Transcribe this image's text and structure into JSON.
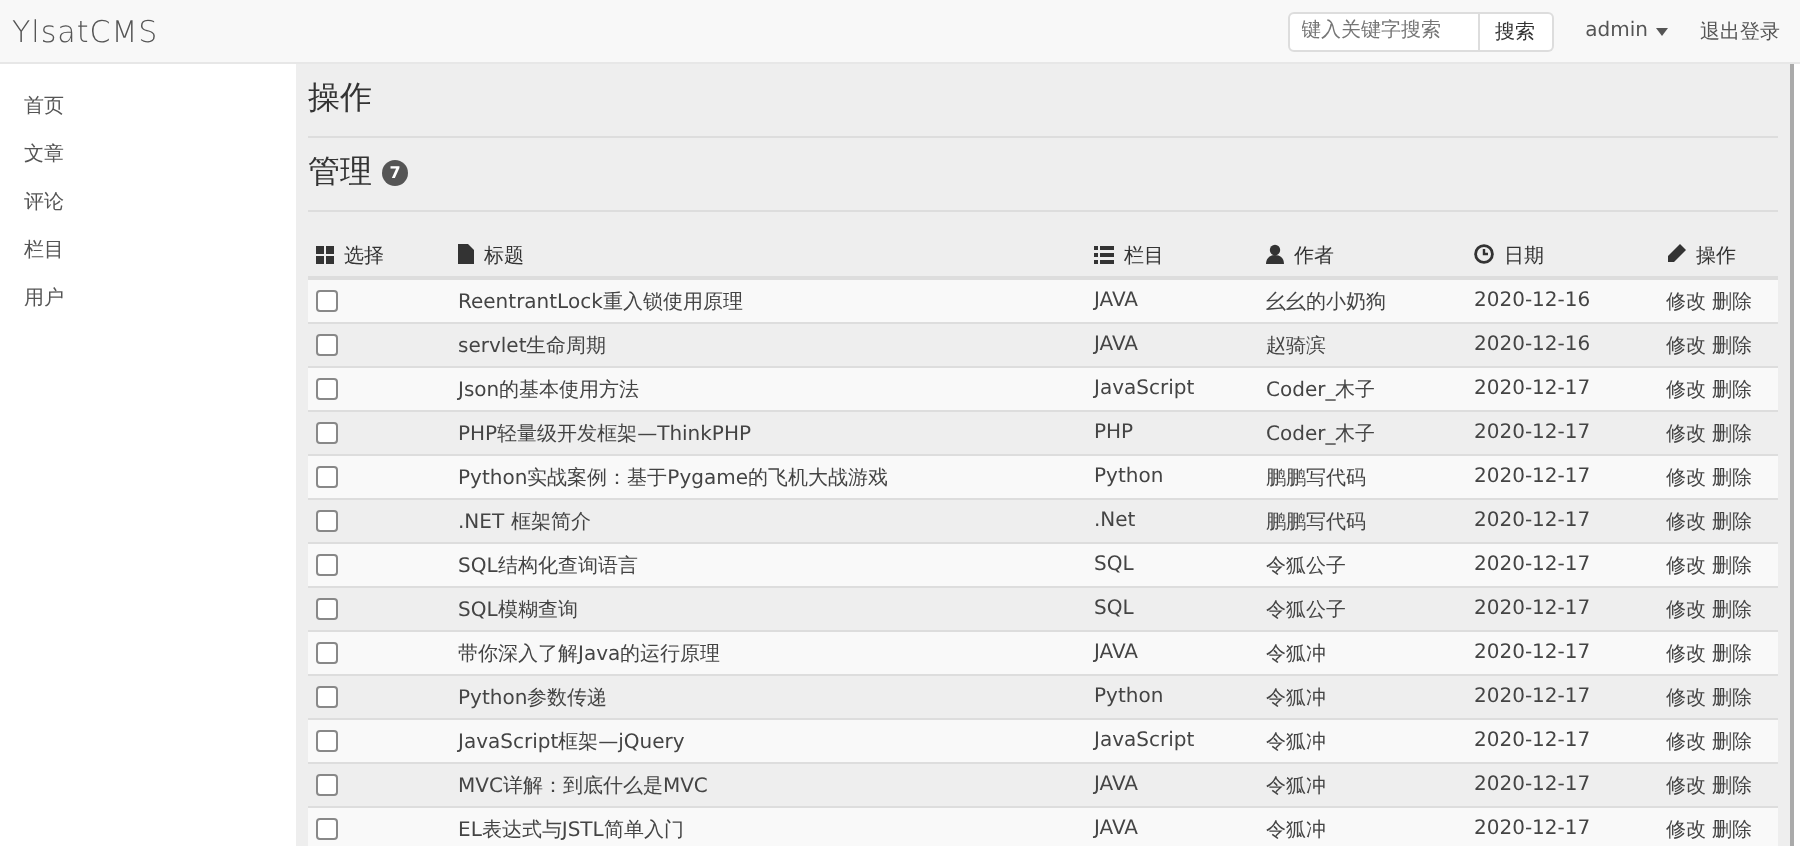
{
  "navbar": {
    "brand": "YlsatCMS",
    "search": {
      "placeholder": "键入关键字搜索",
      "button": "搜索"
    },
    "user": "admin",
    "logout": "退出登录"
  },
  "sidebar": {
    "items": [
      {
        "label": "首页"
      },
      {
        "label": "文章"
      },
      {
        "label": "评论"
      },
      {
        "label": "栏目"
      },
      {
        "label": "用户"
      }
    ]
  },
  "page": {
    "title": "操作",
    "section": "管理",
    "badge": "7"
  },
  "table": {
    "columns": [
      {
        "kind": "select",
        "label": "选择"
      },
      {
        "kind": "title",
        "label": "标题"
      },
      {
        "kind": "category",
        "label": "栏目"
      },
      {
        "kind": "author",
        "label": "作者"
      },
      {
        "kind": "date",
        "label": "日期"
      },
      {
        "kind": "actions",
        "label": "操作"
      }
    ],
    "rows": [
      {
        "checked": false,
        "title": "ReentrantLock重入锁使用原理",
        "category": "JAVA",
        "author": "幺幺的小奶狗",
        "date": "2020-12-16",
        "actions": [
          "修改",
          "删除"
        ]
      },
      {
        "checked": false,
        "title": "servlet生命周期",
        "category": "JAVA",
        "author": "赵骑滨",
        "date": "2020-12-16",
        "actions": [
          "修改",
          "删除"
        ]
      },
      {
        "checked": false,
        "title": "Json的基本使用方法",
        "category": "JavaScript",
        "author": "Coder_木子",
        "date": "2020-12-17",
        "actions": [
          "修改",
          "删除"
        ]
      },
      {
        "checked": false,
        "title": "PHP轻量级开发框架—ThinkPHP",
        "category": "PHP",
        "author": "Coder_木子",
        "date": "2020-12-17",
        "actions": [
          "修改",
          "删除"
        ]
      },
      {
        "checked": false,
        "title": "Python实战案例：基于Pygame的飞机大战游戏",
        "category": "Python",
        "author": "鹏鹏写代码",
        "date": "2020-12-17",
        "actions": [
          "修改",
          "删除"
        ]
      },
      {
        "checked": false,
        "title": ".NET 框架简介",
        "category": ".Net",
        "author": "鹏鹏写代码",
        "date": "2020-12-17",
        "actions": [
          "修改",
          "删除"
        ]
      },
      {
        "checked": false,
        "title": "SQL结构化查询语言",
        "category": "SQL",
        "author": "令狐公子",
        "date": "2020-12-17",
        "actions": [
          "修改",
          "删除"
        ]
      },
      {
        "checked": false,
        "title": "SQL模糊查询",
        "category": "SQL",
        "author": "令狐公子",
        "date": "2020-12-17",
        "actions": [
          "修改",
          "删除"
        ]
      },
      {
        "checked": false,
        "title": "带你深入了解Java的运行原理",
        "category": "JAVA",
        "author": "令狐冲",
        "date": "2020-12-17",
        "actions": [
          "修改",
          "删除"
        ]
      },
      {
        "checked": false,
        "title": "Python参数传递",
        "category": "Python",
        "author": "令狐冲",
        "date": "2020-12-17",
        "actions": [
          "修改",
          "删除"
        ]
      },
      {
        "checked": false,
        "title": "JavaScript框架—jQuery",
        "category": "JavaScript",
        "author": "令狐冲",
        "date": "2020-12-17",
        "actions": [
          "修改",
          "删除"
        ]
      },
      {
        "checked": false,
        "title": "MVC详解：到底什么是MVC",
        "category": "JAVA",
        "author": "令狐冲",
        "date": "2020-12-17",
        "actions": [
          "修改",
          "删除"
        ]
      },
      {
        "checked": false,
        "title": "EL表达式与JSTL简单入门",
        "category": "JAVA",
        "author": "令狐冲",
        "date": "2020-12-17",
        "actions": [
          "修改",
          "删除"
        ]
      }
    ]
  }
}
